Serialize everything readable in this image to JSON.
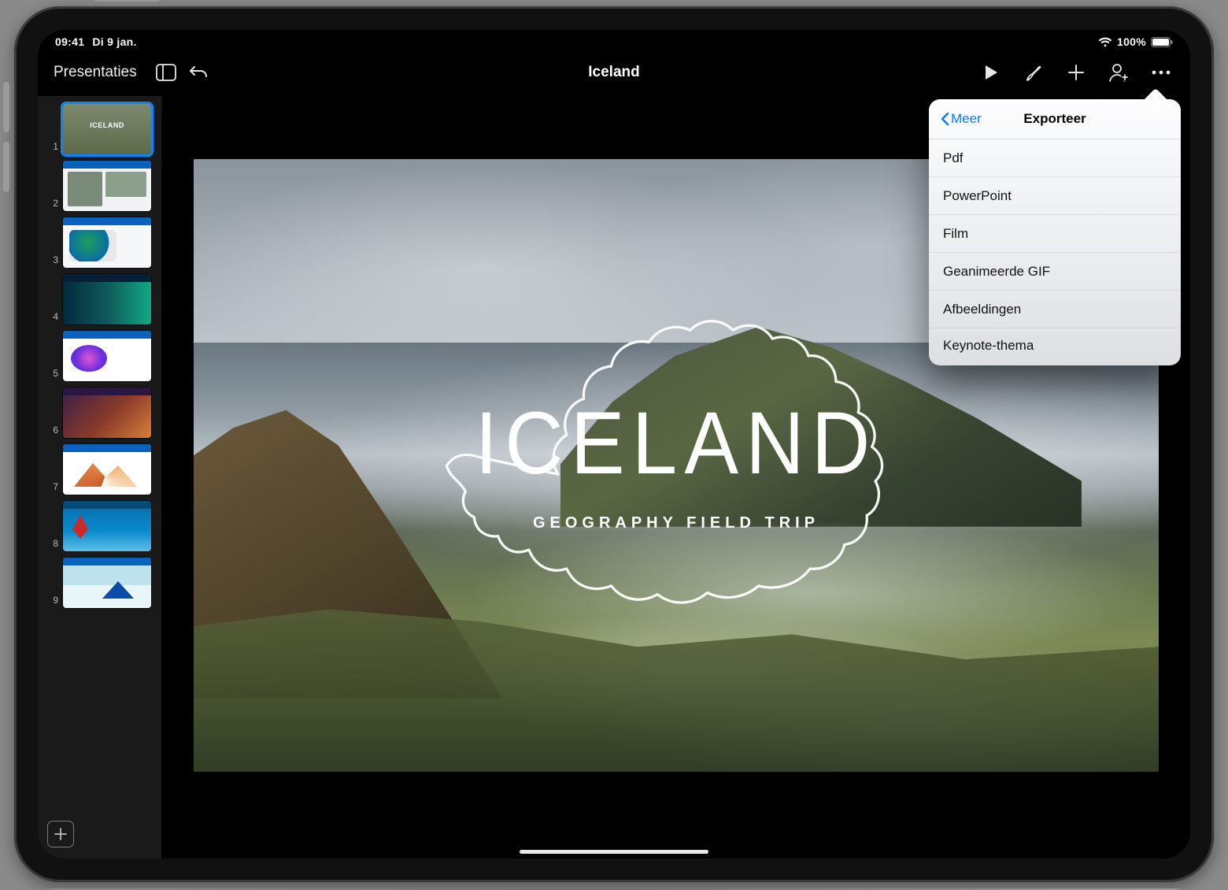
{
  "status": {
    "time": "09:41",
    "date": "Di 9 jan.",
    "battery_pct": "100%"
  },
  "toolbar": {
    "back_label": "Presentaties",
    "document_title": "Iceland"
  },
  "slide": {
    "title": "ICELAND",
    "subtitle": "GEOGRAPHY FIELD TRIP"
  },
  "thumbnails": {
    "count": 9,
    "numbers": [
      "1",
      "2",
      "3",
      "4",
      "5",
      "6",
      "7",
      "8",
      "9"
    ],
    "selected_index": 0,
    "thumb1_label": "ICELAND"
  },
  "popover": {
    "back_label": "Meer",
    "title": "Exporteer",
    "items": [
      "Pdf",
      "PowerPoint",
      "Film",
      "Geanimeerde GIF",
      "Afbeeldingen",
      "Keynote-thema"
    ]
  }
}
